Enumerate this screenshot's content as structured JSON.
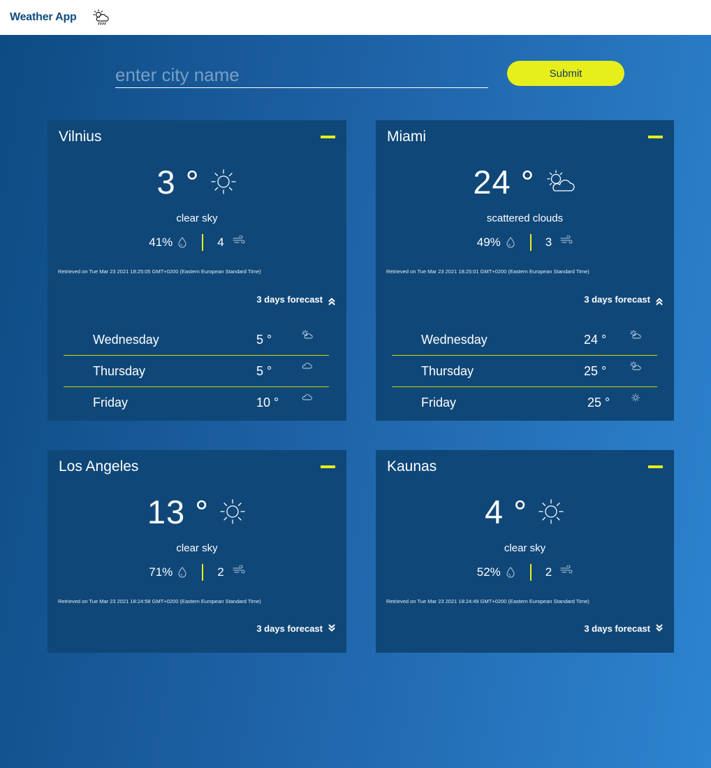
{
  "app": {
    "title": "Weather App",
    "icon": "sun-cloud-rain-icon"
  },
  "search": {
    "placeholder": "enter city name",
    "value": "",
    "submit_label": "Submit"
  },
  "colors": {
    "accent": "#e6ef1c",
    "card_bg": "#0f4778",
    "gradient_start": "#0d4b83",
    "gradient_end": "#2d84d0",
    "brand": "#0f4c81"
  },
  "cards": [
    {
      "city": "Vilnius",
      "temp": "3 °",
      "icon": "sun-icon",
      "description": "clear sky",
      "humidity": "41%",
      "wind": "4",
      "retrieved": "Retrieved on Tue Mar 23 2021 18:25:05 GMT+0200 (Eastern European Standard Time)",
      "forecast_label": "3 days forecast",
      "forecast_expanded": true,
      "forecast": [
        {
          "day": "Wednesday",
          "temp": "5 °",
          "icon": "sun-cloud-icon"
        },
        {
          "day": "Thursday",
          "temp": "5 °",
          "icon": "cloud-icon"
        },
        {
          "day": "Friday",
          "temp": "10 °",
          "icon": "cloud-icon"
        }
      ]
    },
    {
      "city": "Miami",
      "temp": "24 °",
      "icon": "sun-cloud-icon",
      "description": "scattered clouds",
      "humidity": "49%",
      "wind": "3",
      "retrieved": "Retrieved on Tue Mar 23 2021 18:25:01 GMT+0200 (Eastern European Standard Time)",
      "forecast_label": "3 days forecast",
      "forecast_expanded": true,
      "forecast": [
        {
          "day": "Wednesday",
          "temp": "24 °",
          "icon": "sun-cloud-icon"
        },
        {
          "day": "Thursday",
          "temp": "25 °",
          "icon": "sun-cloud-icon"
        },
        {
          "day": "Friday",
          "temp": "25 °",
          "icon": "sun-icon"
        }
      ]
    },
    {
      "city": "Los Angeles",
      "temp": "13 °",
      "icon": "sun-icon",
      "description": "clear sky",
      "humidity": "71%",
      "wind": "2",
      "retrieved": "Retrieved on Tue Mar 23 2021 18:24:58 GMT+0200 (Eastern European Standard Time)",
      "forecast_label": "3 days forecast",
      "forecast_expanded": false,
      "forecast": []
    },
    {
      "city": "Kaunas",
      "temp": "4 °",
      "icon": "sun-icon",
      "description": "clear sky",
      "humidity": "52%",
      "wind": "2",
      "retrieved": "Retrieved on Tue Mar 23 2021 18:24:49 GMT+0200 (Eastern European Standard Time)",
      "forecast_label": "3 days forecast",
      "forecast_expanded": false,
      "forecast": []
    }
  ]
}
